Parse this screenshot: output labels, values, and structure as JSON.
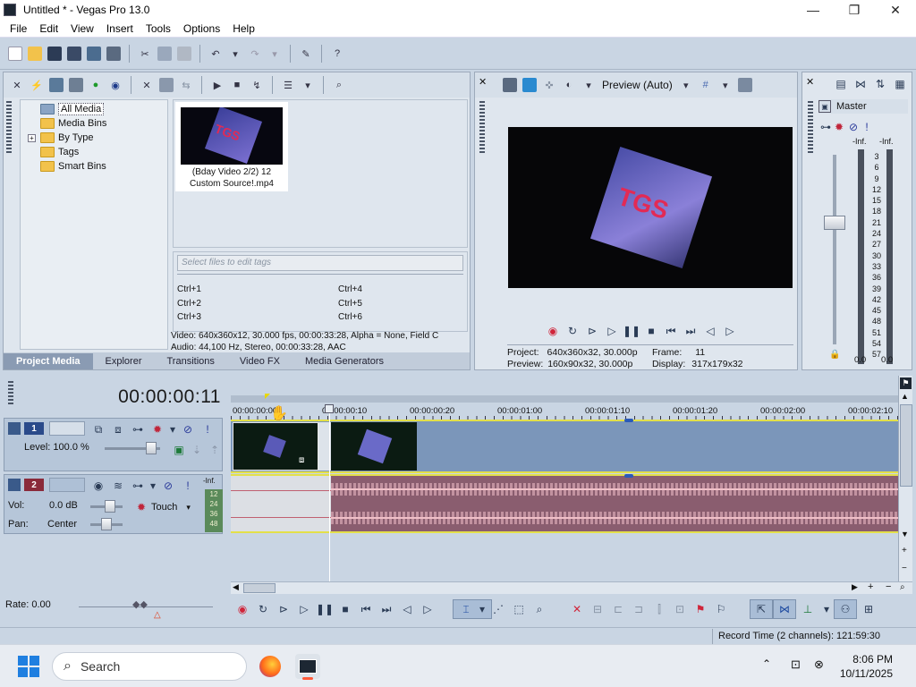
{
  "window": {
    "title": "Untitled * - Vegas Pro 13.0",
    "minimize": "—",
    "maximize": "❐",
    "close": "✕"
  },
  "menu": [
    "File",
    "Edit",
    "View",
    "Insert",
    "Tools",
    "Options",
    "Help"
  ],
  "project_media": {
    "tree": [
      {
        "label": "All Media",
        "selected": true
      },
      {
        "label": "Media Bins"
      },
      {
        "label": "By Type",
        "expander": "+"
      },
      {
        "label": "Tags"
      },
      {
        "label": "Smart Bins"
      }
    ],
    "file": {
      "caption_line1": "(Bday Video 2/2) 12",
      "caption_line2": "Custom Source!.mp4",
      "thumb_text": "TGS"
    },
    "tags_placeholder": "Select files to edit tags",
    "shortcuts": [
      "Ctrl+1",
      "Ctrl+2",
      "Ctrl+3",
      "Ctrl+4",
      "Ctrl+5",
      "Ctrl+6"
    ],
    "info_video": "Video: 640x360x12, 30.000 fps, 00:00:33:28, Alpha = None, Field C",
    "info_audio": "Audio: 44,100 Hz, Stereo, 00:00:33:28, AAC",
    "tabs": [
      "Project Media",
      "Explorer",
      "Transitions",
      "Video FX",
      "Media Generators"
    ]
  },
  "preview": {
    "quality": "Preview (Auto)",
    "video_text": "TGS",
    "project_label": "Project:",
    "project_value": "640x360x32, 30.000p",
    "preview_label": "Preview:",
    "preview_value": "160x90x32, 30.000p",
    "frame_label": "Frame:",
    "frame_value": "11",
    "display_label": "Display:",
    "display_value": "317x179x32"
  },
  "master": {
    "title": "Master",
    "inf_left": "-Inf.",
    "inf_right": "-Inf.",
    "scale": [
      "3",
      "6",
      "9",
      "12",
      "15",
      "18",
      "21",
      "24",
      "27",
      "30",
      "33",
      "36",
      "39",
      "42",
      "45",
      "48",
      "51",
      "54",
      "57"
    ],
    "bottom_left": "0.0",
    "bottom_right": "0.0"
  },
  "timeline": {
    "timecode": "00:00:00:11",
    "ruler_labels": [
      "00:00:00:00",
      "00:00:00:10",
      "00:00:00:20",
      "00:00:01:00",
      "00:00:01:10",
      "00:00:01:20",
      "00:00:02:00",
      "00:00:02:10"
    ],
    "video_track": {
      "number": "1",
      "level_label": "Level: 100.0 %"
    },
    "audio_track": {
      "number": "2",
      "vol_label": "Vol:",
      "vol_value": "0.0 dB",
      "pan_label": "Pan:",
      "pan_value": "Center",
      "mode": "Touch",
      "meter_top": "-Inf.",
      "meter_marks": [
        "12",
        "24",
        "36",
        "48"
      ]
    }
  },
  "bottom": {
    "rate": "Rate: 0.00",
    "record_time": "Record Time (2 channels): 121:59:30"
  },
  "taskbar": {
    "search": "Search",
    "time": "8:06 PM",
    "date": "10/11/2025"
  },
  "colors": {
    "accent": "#1f7fe0",
    "video_lane": "#7b96ba",
    "audio_lane": "#8a5d6f",
    "track_yellow": "#e3e04a"
  }
}
